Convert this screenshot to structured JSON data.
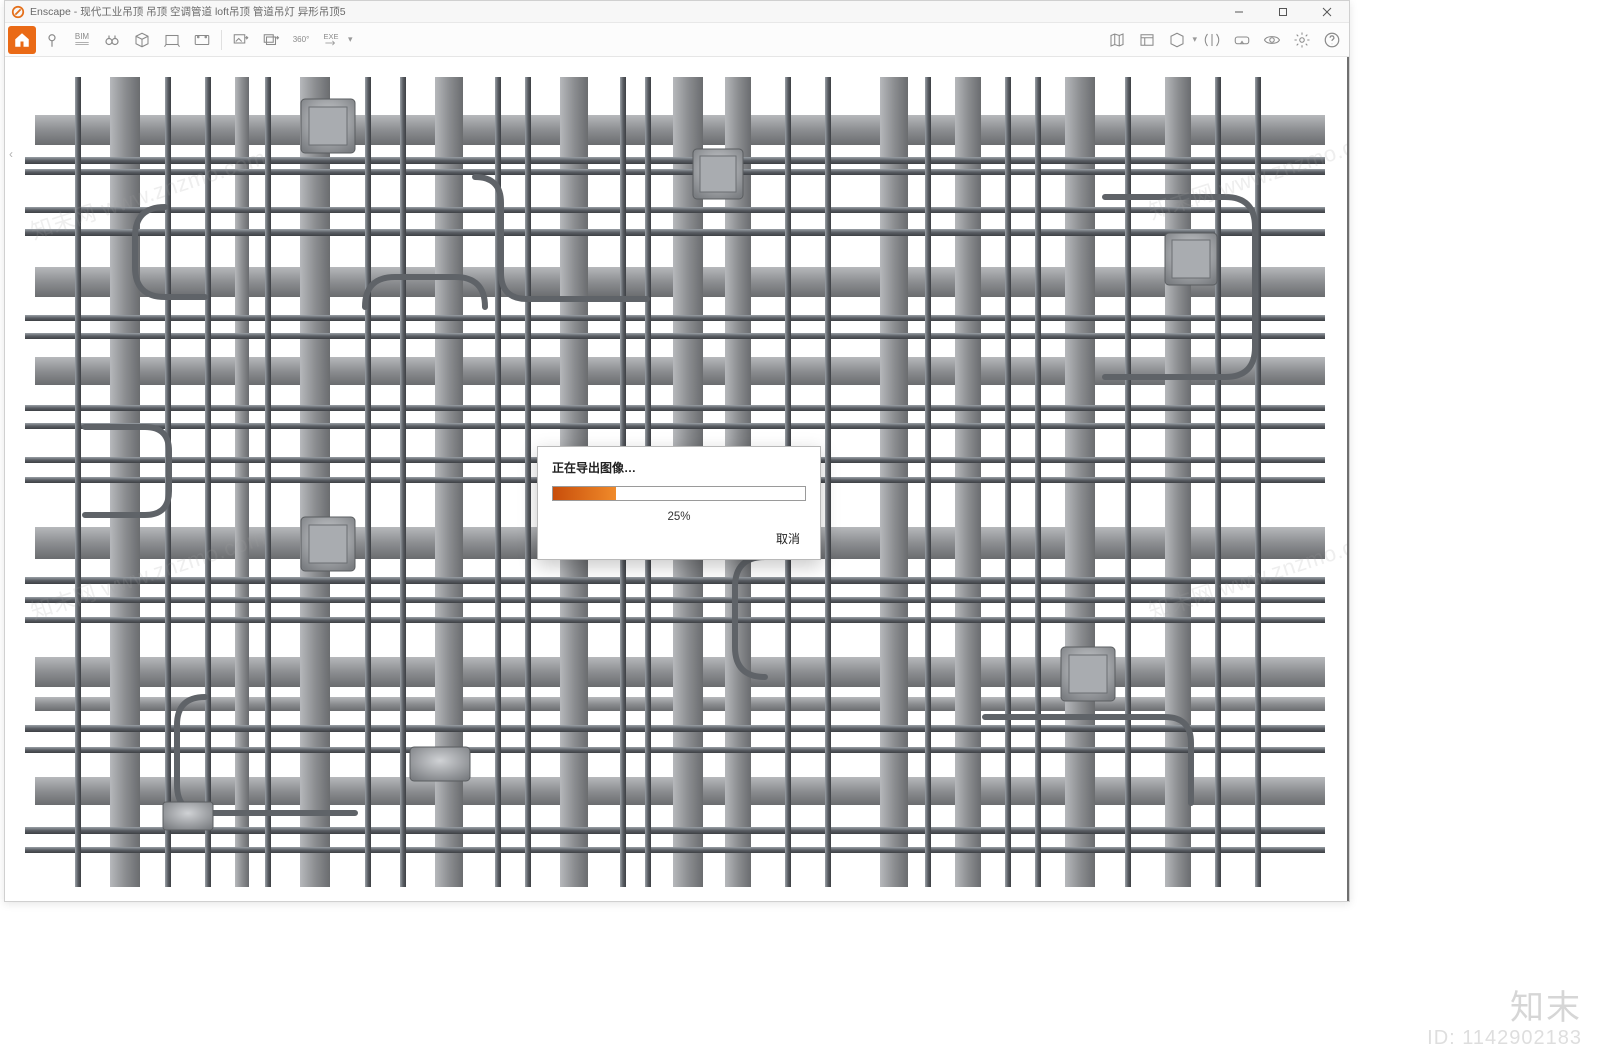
{
  "window": {
    "app_name": "Enscape",
    "title_suffix": "现代工业吊顶 吊顶 空调管道 loft吊顶 管道吊灯 异形吊顶5"
  },
  "toolbar": {
    "left_icons": [
      {
        "name": "home-icon",
        "label": "Home",
        "active": true
      },
      {
        "name": "pin-icon",
        "label": "Pin"
      },
      {
        "name": "bim-icon",
        "label": "BIM",
        "text": "BIM"
      },
      {
        "name": "binoculars-icon",
        "label": "Find"
      },
      {
        "name": "view-cube-icon",
        "label": "View Cube"
      },
      {
        "name": "walkthrough-icon",
        "label": "Walk"
      },
      {
        "name": "video-icon",
        "label": "Video"
      },
      {
        "name": "export-image-icon",
        "label": "Export Image"
      },
      {
        "name": "export-batch-icon",
        "label": "Export Batch"
      },
      {
        "name": "pano-360-icon",
        "label": "360",
        "text": "360°"
      },
      {
        "name": "export-exe-icon",
        "label": "EXE",
        "text": "EXE"
      }
    ],
    "right_icons": [
      {
        "name": "minimap-icon",
        "label": "Mini Map"
      },
      {
        "name": "asset-library-icon",
        "label": "Asset Library"
      },
      {
        "name": "cube-icon",
        "label": "3D"
      },
      {
        "name": "compare-icon",
        "label": "Compare"
      },
      {
        "name": "vr-icon",
        "label": "VR"
      },
      {
        "name": "visibility-icon",
        "label": "Visibility"
      },
      {
        "name": "settings-icon",
        "label": "Settings"
      },
      {
        "name": "help-icon",
        "label": "Help"
      }
    ]
  },
  "dialog": {
    "title": "正在导出图像…",
    "progress_percent": 25,
    "progress_label": "25%",
    "cancel_label": "取消"
  },
  "watermark": {
    "diag_text": "知末网 www.znzmo.com",
    "brand": "知末",
    "id_label": "ID: 1142902183"
  },
  "colors": {
    "accent": "#ea6a16",
    "progress_start": "#c84e0b",
    "progress_end": "#f08a2a"
  }
}
